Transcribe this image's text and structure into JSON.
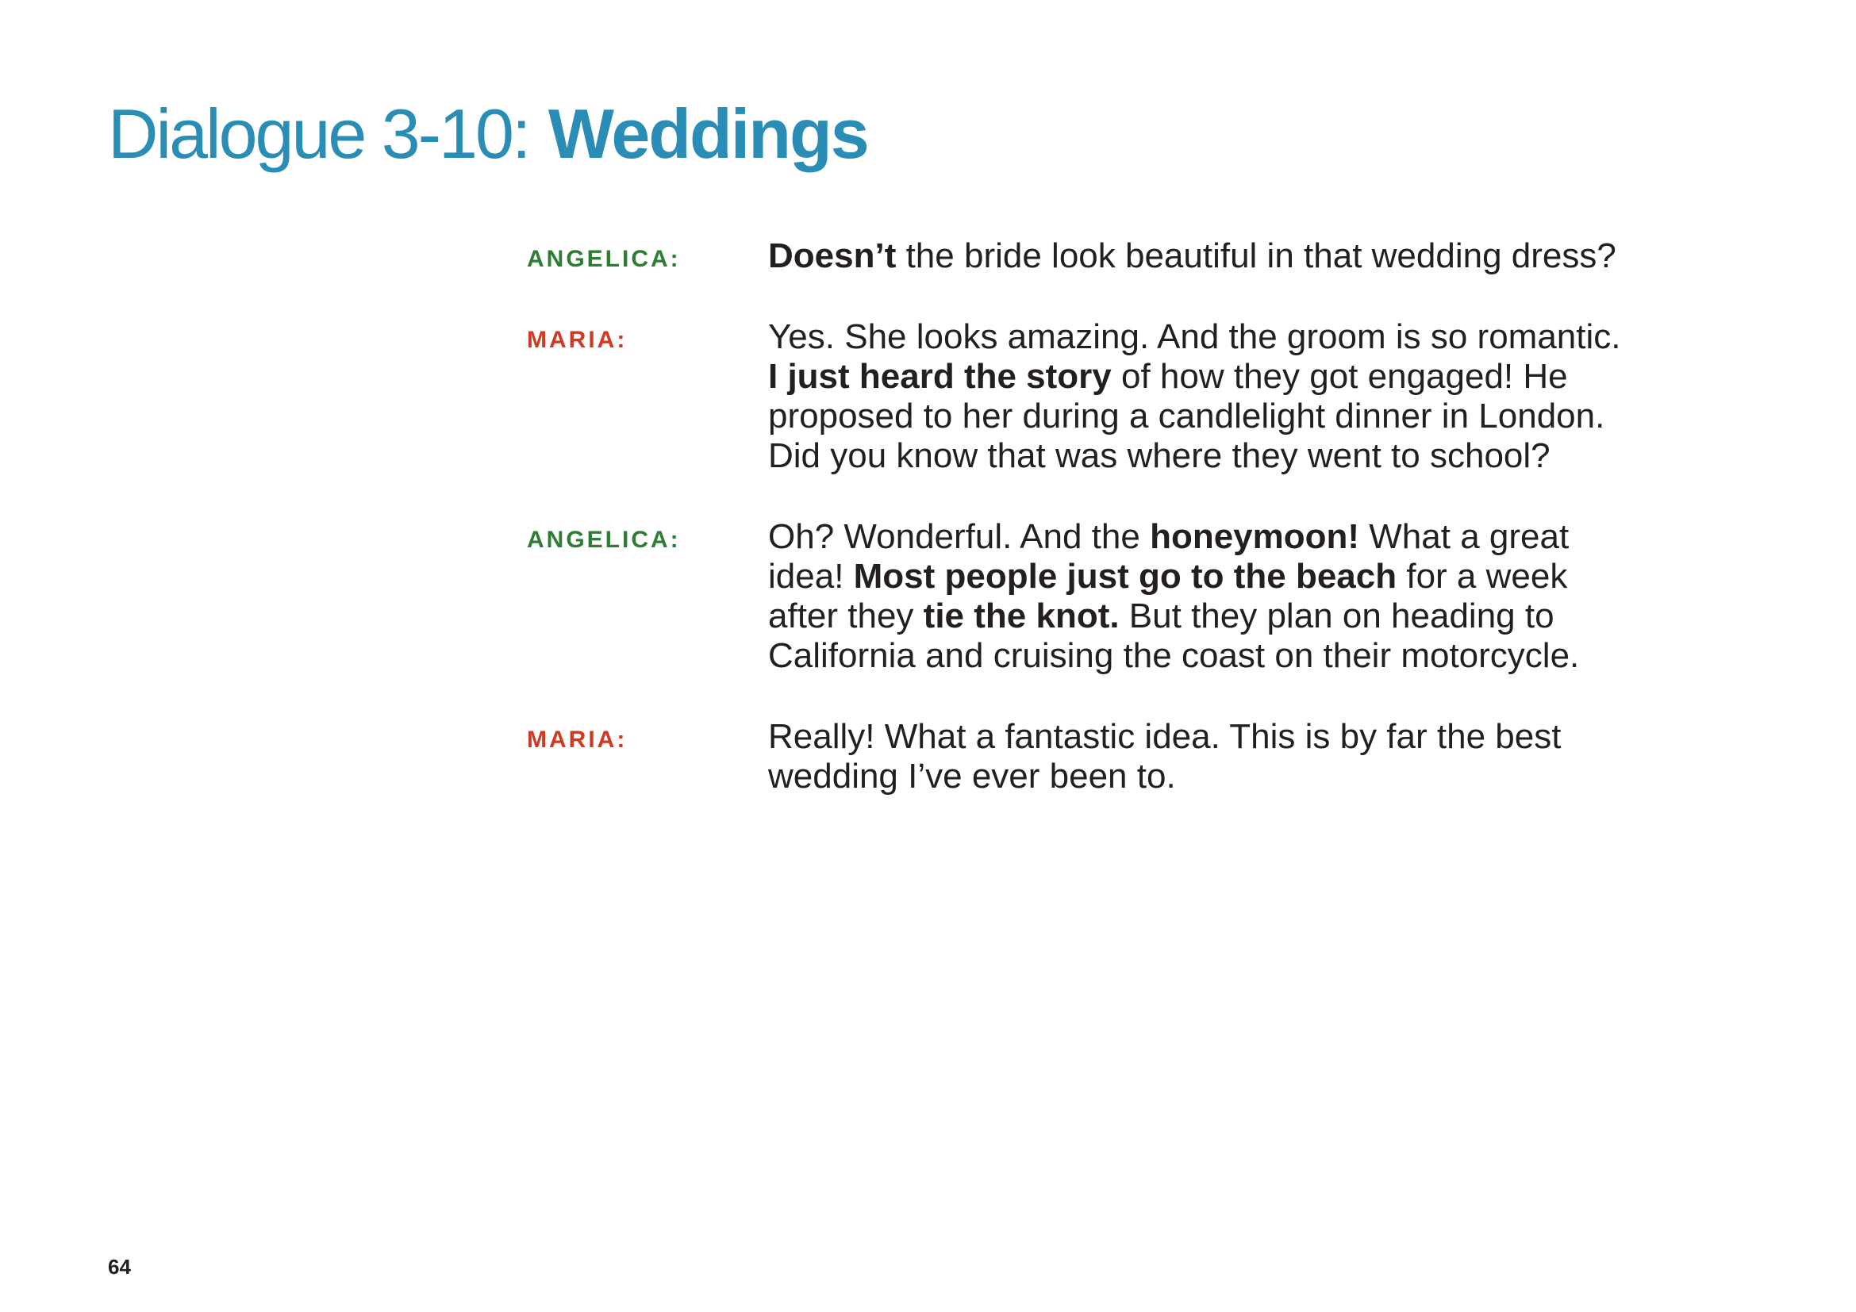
{
  "title": {
    "prefix": "Dialogue 3-10:",
    "main": "Weddings"
  },
  "colors": {
    "title": "#2a8db5",
    "angelica": "#2e7d32",
    "maria": "#d03a23",
    "text": "#231f20"
  },
  "dialogue": [
    {
      "speaker": "ANGELICA:",
      "lines": [
        [
          {
            "text": "Doesn’t",
            "bold": true
          },
          {
            "text": " the bride look beautiful in that wedding dress?",
            "bold": false
          }
        ]
      ]
    },
    {
      "speaker": "MARIA:",
      "lines": [
        [
          {
            "text": "Yes. She looks amazing. And the groom is so romantic.",
            "bold": false
          }
        ],
        [
          {
            "text": "I just heard the story",
            "bold": true
          },
          {
            "text": " of how they got engaged! He",
            "bold": false
          }
        ],
        [
          {
            "text": "proposed to her during a candlelight dinner in London.",
            "bold": false
          }
        ],
        [
          {
            "text": "Did you know that was where they went to school?",
            "bold": false
          }
        ]
      ]
    },
    {
      "speaker": "ANGELICA:",
      "lines": [
        [
          {
            "text": "Oh? Wonderful. And the ",
            "bold": false
          },
          {
            "text": "honeymoon!",
            "bold": true
          },
          {
            "text": " What a great",
            "bold": false
          }
        ],
        [
          {
            "text": "idea! ",
            "bold": false
          },
          {
            "text": "Most people just go to the beach",
            "bold": true
          },
          {
            "text": " for a week",
            "bold": false
          }
        ],
        [
          {
            "text": "after they ",
            "bold": false
          },
          {
            "text": "tie the knot.",
            "bold": true
          },
          {
            "text": " But they plan on heading to",
            "bold": false
          }
        ],
        [
          {
            "text": "California and cruising the coast on their motorcycle.",
            "bold": false
          }
        ]
      ]
    },
    {
      "speaker": "MARIA:",
      "lines": [
        [
          {
            "text": "Really! What a fantastic idea. This is by far the best",
            "bold": false
          }
        ],
        [
          {
            "text": "wedding I’ve ever been to.",
            "bold": false
          }
        ]
      ]
    }
  ],
  "page_number": "64"
}
